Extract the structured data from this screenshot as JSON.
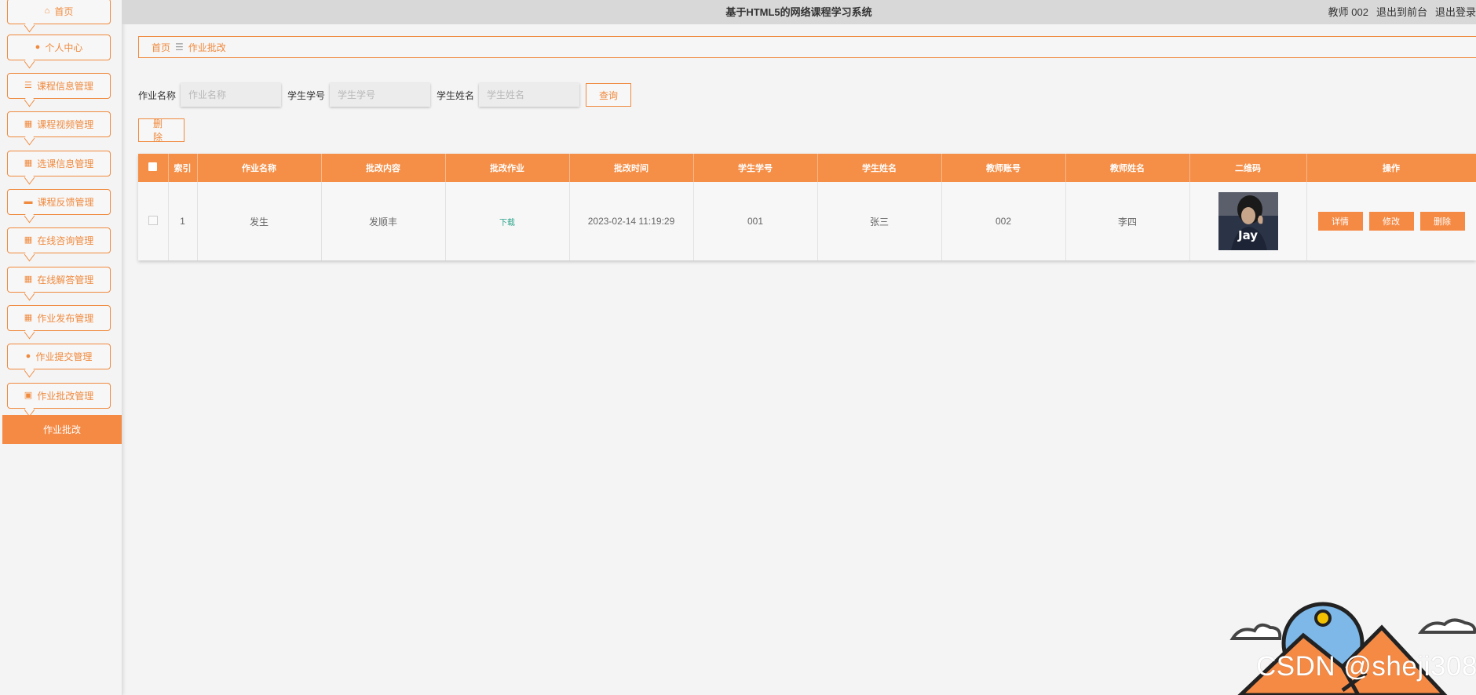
{
  "header": {
    "title": "基于HTML5的网络课程学习系统",
    "user_label": "教师 002",
    "front_link": "退出到前台",
    "logout_link": "退出登录"
  },
  "sidebar": {
    "items": [
      {
        "label": "首页",
        "icon": "home-icon"
      },
      {
        "label": "个人中心",
        "icon": "user-icon"
      },
      {
        "label": "课程信息管理",
        "icon": "list-icon"
      },
      {
        "label": "课程视频管理",
        "icon": "grid-icon"
      },
      {
        "label": "选课信息管理",
        "icon": "grid-icon"
      },
      {
        "label": "课程反馈管理",
        "icon": "chat-icon"
      },
      {
        "label": "在线咨询管理",
        "icon": "grid-icon"
      },
      {
        "label": "在线解答管理",
        "icon": "grid-icon"
      },
      {
        "label": "作业发布管理",
        "icon": "grid-icon"
      },
      {
        "label": "作业提交管理",
        "icon": "pin-icon"
      },
      {
        "label": "作业批改管理",
        "icon": "clipboard-icon"
      }
    ],
    "sub_active": "作业批改"
  },
  "breadcrumb": {
    "home": "首页",
    "sep": "☰",
    "current": "作业批改"
  },
  "search": {
    "f1_label": "作业名称",
    "f1_placeholder": "作业名称",
    "f2_label": "学生学号",
    "f2_placeholder": "学生学号",
    "f3_label": "学生姓名",
    "f3_placeholder": "学生姓名",
    "query_label": "查询",
    "delete_label": "删除"
  },
  "table": {
    "headers": [
      "索引",
      "作业名称",
      "批改内容",
      "批改作业",
      "批改时间",
      "学生学号",
      "学生姓名",
      "教师账号",
      "教师姓名",
      "二维码",
      "操作"
    ],
    "rows": [
      {
        "index": "1",
        "hw_name": "发生",
        "content": "发顺丰",
        "file": "下载",
        "time": "2023-02-14 11:19:29",
        "stu_no": "001",
        "stu_name": "张三",
        "teacher_no": "002",
        "teacher_name": "李四",
        "qr_text": "Jay",
        "ops": [
          "详情",
          "修改",
          "删除"
        ]
      }
    ]
  },
  "watermark": "CSDN @sheji308",
  "colors": {
    "accent": "#f58a45",
    "header_bg": "#d9d8d8",
    "page_bg": "#f4f4f4",
    "link_green": "#2aa38b"
  }
}
